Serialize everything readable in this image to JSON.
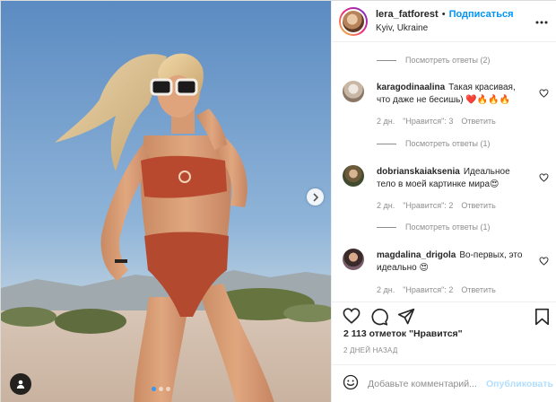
{
  "post": {
    "image": {
      "carousel_dots": 3,
      "active_dot": 0,
      "next_icon": "chevron-right-icon",
      "user_tag_icon": "user-tag-icon"
    },
    "header": {
      "username": "lera_fatforest",
      "separator": "•",
      "follow_label": "Подписаться",
      "location": "Kyiv, Ukraine",
      "more_icon": "more-icon"
    },
    "comments": {
      "replies_top": "Посмотреть ответы (2)",
      "items": [
        {
          "username": "karagodinaalina",
          "text": "Такая красивая, что даже не бесишь) ❤️🔥🔥🔥",
          "time": "2 дн.",
          "likes": "\"Нравится\": 3",
          "reply": "Ответить",
          "replies": "Посмотреть ответы (1)"
        },
        {
          "username": "dobrianskaiaksenia",
          "text": "Идеальное тело в моей картинке мира😍",
          "time": "2 дн.",
          "likes": "\"Нравится\": 2",
          "reply": "Ответить",
          "replies": "Посмотреть ответы (1)"
        },
        {
          "username": "magdalina_drigola",
          "text": "Во-первых, это идеально 😍",
          "time": "2 дн.",
          "likes": "\"Нравится\": 2",
          "reply": "Ответить"
        }
      ]
    },
    "actions": {
      "like_icon": "heart-icon",
      "comment_icon": "comment-icon",
      "share_icon": "share-icon",
      "save_icon": "bookmark-icon"
    },
    "likes_text": "2 113 отметок \"Нравится\"",
    "date": "2 ДНЕЙ НАЗАД",
    "comment_box": {
      "emoji_icon": "emoji-icon",
      "placeholder": "Добавьте комментарий...",
      "publish_label": "Опубликовать"
    },
    "colors": {
      "accent": "#0095f6",
      "publish_disabled": "#b2dffc",
      "secondary_text": "#8e8e8e",
      "border": "#dbdbdb"
    }
  }
}
